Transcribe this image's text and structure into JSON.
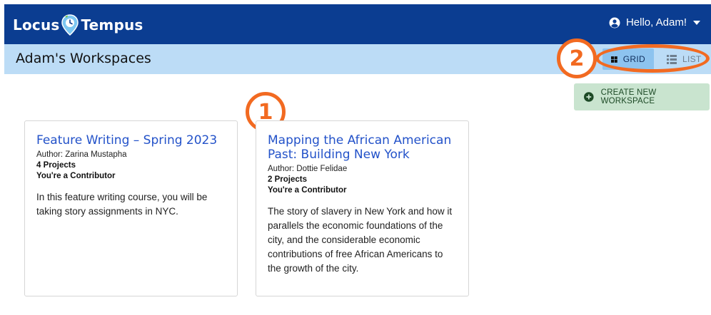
{
  "header": {
    "logo_left": "Locus",
    "logo_right": "Tempus",
    "greeting": "Hello, Adam!"
  },
  "subheader": {
    "title": "Adam's Workspaces"
  },
  "view_toggle": {
    "grid_label": "GRID",
    "list_label": "LIST",
    "selected": "GRID"
  },
  "actions": {
    "create_label": "CREATE NEW WORKSPACE"
  },
  "callouts": {
    "one": "1",
    "two": "2"
  },
  "workspaces": [
    {
      "title": "Feature Writing – Spring 2023",
      "author": "Author: Zarina Mustapha",
      "projects": "4 Projects",
      "role": "You're a Contributor",
      "description": "In this feature writing course, you will be taking story assignments in NYC."
    },
    {
      "title": "Mapping the African American Past: Building New York",
      "author": "Author: Dottie Felidae",
      "projects": "2 Projects",
      "role": "You're a Contributor",
      "description": "The story of slavery in New York and how it parallels the economic foundations of the city, and the considerable economic contributions of free African Americans to the growth of the city."
    }
  ],
  "colors": {
    "topbar": "#0b3d91",
    "subbar": "#bcdcf6",
    "grid_active": "#8dc3ef",
    "create_button": "#c9e4cf",
    "callout": "#f26a21",
    "card_title": "#2352c9"
  },
  "icons": {
    "logo": "map-pin-clock-icon",
    "user": "user-circle-icon",
    "caret": "caret-down-icon",
    "grid": "grid-icon",
    "list": "list-icon",
    "create": "plus-circle-icon"
  }
}
